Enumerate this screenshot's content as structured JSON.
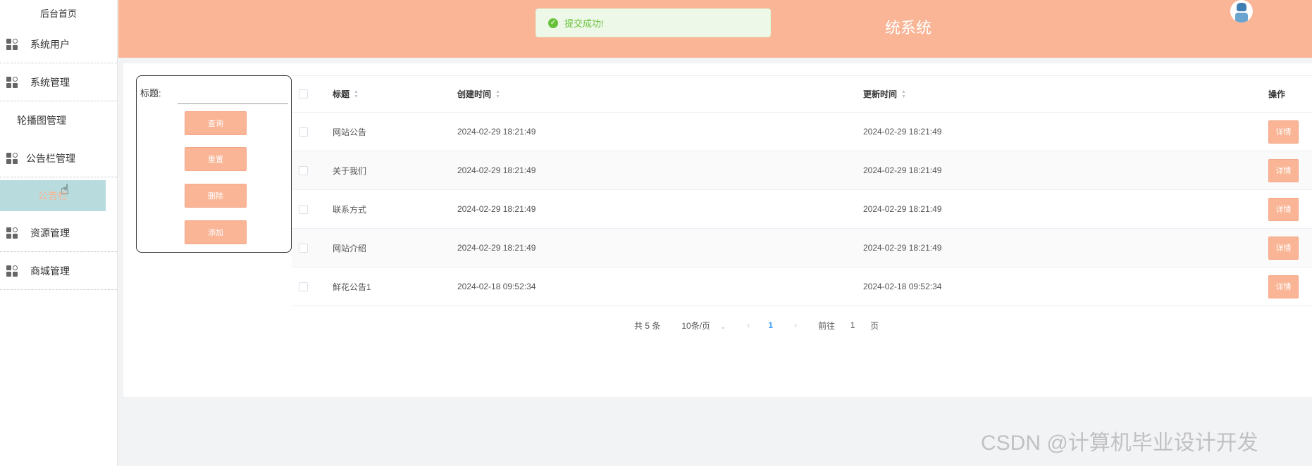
{
  "sidebar": {
    "home": "后台首页",
    "items": [
      {
        "label": "系统用户"
      },
      {
        "label": "系统管理"
      },
      {
        "label": "轮播图管理"
      },
      {
        "label": "公告栏管理"
      },
      {
        "label": "公告栏"
      },
      {
        "label": "资源管理"
      },
      {
        "label": "商城管理"
      }
    ]
  },
  "header": {
    "title": "统系统"
  },
  "toast": {
    "message": "提交成功!"
  },
  "filter": {
    "label": "标题:",
    "input_value": "",
    "buttons": {
      "query": "查询",
      "reset": "重置",
      "delete": "删除",
      "add": "添加"
    }
  },
  "table": {
    "headers": {
      "title": "标题",
      "created": "创建时间",
      "updated": "更新时间",
      "op": "操作"
    },
    "rows": [
      {
        "title": "网站公告",
        "created": "2024-02-29 18:21:49",
        "updated": "2024-02-29 18:21:49",
        "action": "详情"
      },
      {
        "title": "关于我们",
        "created": "2024-02-29 18:21:49",
        "updated": "2024-02-29 18:21:49",
        "action": "详情"
      },
      {
        "title": "联系方式",
        "created": "2024-02-29 18:21:49",
        "updated": "2024-02-29 18:21:49",
        "action": "详情"
      },
      {
        "title": "网站介绍",
        "created": "2024-02-29 18:21:49",
        "updated": "2024-02-29 18:21:49",
        "action": "详情"
      },
      {
        "title": "鲜花公告1",
        "created": "2024-02-18 09:52:34",
        "updated": "2024-02-18 09:52:34",
        "action": "详情"
      }
    ]
  },
  "pagination": {
    "total": "共 5 条",
    "page_size": "10条/页",
    "prev": "‹",
    "current": "1",
    "next": "›",
    "goto_label": "前往",
    "goto_value": "1",
    "page_suffix": "页"
  },
  "watermark": "CSDN @计算机毕业设计开发",
  "colors": {
    "accent": "#f9b596",
    "submenu_active": "#b8dcde",
    "success": "#67c23a",
    "page_active": "#409eff"
  }
}
